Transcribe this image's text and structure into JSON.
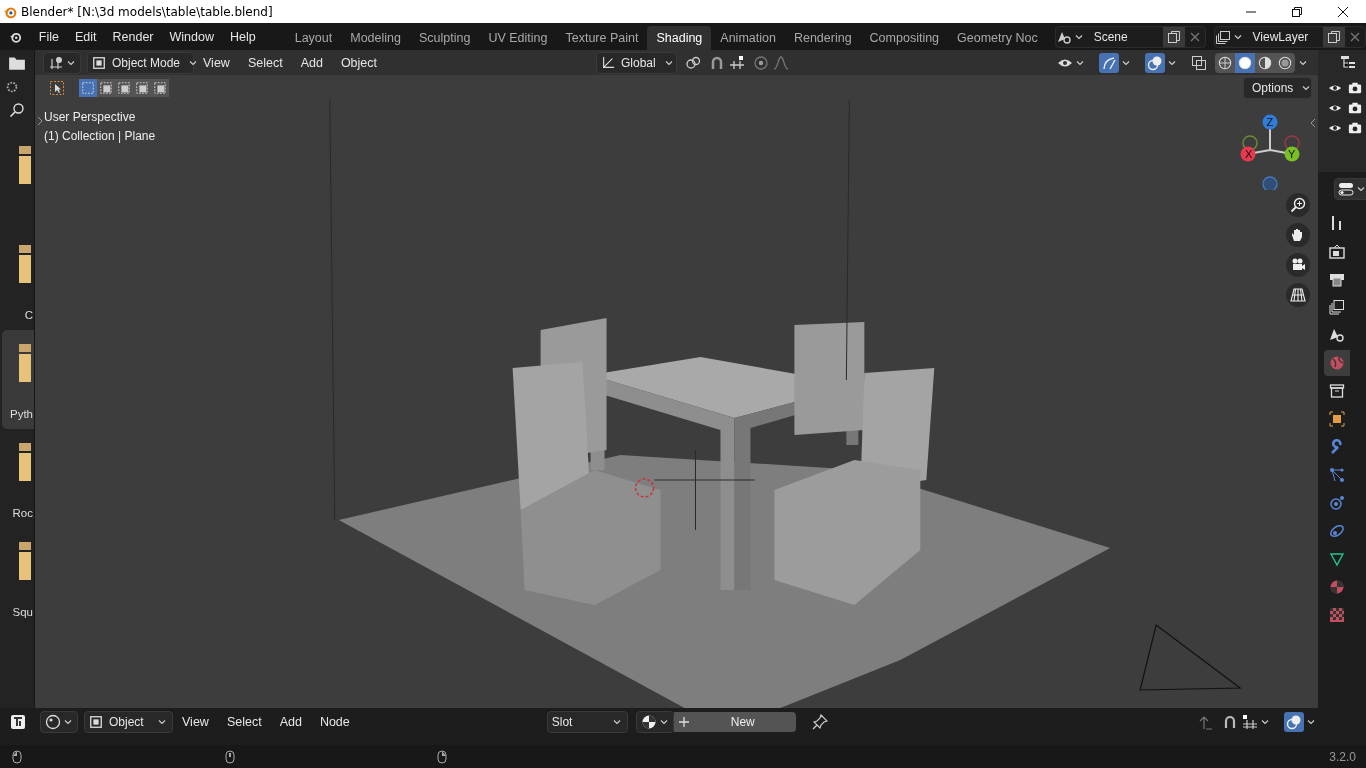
{
  "window": {
    "title": "Blender* [N:\\3d models\\table\\table.blend]"
  },
  "menu": [
    "File",
    "Edit",
    "Render",
    "Window",
    "Help"
  ],
  "workspaces": [
    {
      "label": "Layout",
      "selected": false
    },
    {
      "label": "Modeling",
      "selected": false
    },
    {
      "label": "Sculpting",
      "selected": false
    },
    {
      "label": "UV Editing",
      "selected": false
    },
    {
      "label": "Texture Paint",
      "selected": false
    },
    {
      "label": "Shading",
      "selected": true
    },
    {
      "label": "Animation",
      "selected": false
    },
    {
      "label": "Rendering",
      "selected": false
    },
    {
      "label": "Compositing",
      "selected": false
    },
    {
      "label": "Geometry Noc",
      "selected": false
    }
  ],
  "scene": {
    "name": "Scene"
  },
  "view_layer": {
    "name": "ViewLayer"
  },
  "asset_strip": {
    "items": [
      {
        "selected": false
      },
      {
        "label": "C",
        "selected": false
      },
      {
        "label": "Pyth",
        "selected": true
      },
      {
        "label": "Roc",
        "selected": false
      },
      {
        "label": "Squ",
        "selected": false
      }
    ]
  },
  "viewport": {
    "mode": "Object Mode",
    "menus": [
      "View",
      "Select",
      "Add",
      "Object"
    ],
    "orientation": "Global",
    "gizmos_on": true,
    "overlays_on": true,
    "select_modes": [
      {
        "selected": true
      },
      {
        "selected": false
      },
      {
        "selected": false
      },
      {
        "selected": false
      },
      {
        "selected": false
      }
    ],
    "shading_modes": [
      {
        "selected": false
      },
      {
        "selected": true
      },
      {
        "selected": false
      },
      {
        "selected": false
      }
    ],
    "options": "Options",
    "view_name": "User Perspective",
    "context": "(1) Collection | Plane",
    "axes": [
      "X",
      "Y",
      "Z"
    ]
  },
  "properties_tabs": [
    {
      "kind": "tool",
      "selected": false
    },
    {
      "kind": "render",
      "selected": false
    },
    {
      "kind": "output",
      "selected": false
    },
    {
      "kind": "viewlayer",
      "selected": false
    },
    {
      "kind": "scene",
      "selected": false
    },
    {
      "kind": "world",
      "selected": true
    },
    {
      "kind": "collection",
      "selected": false
    },
    {
      "kind": "object",
      "selected": false
    },
    {
      "kind": "modifier",
      "selected": false
    },
    {
      "kind": "particles",
      "selected": false
    },
    {
      "kind": "physics",
      "selected": false
    },
    {
      "kind": "constraint",
      "selected": false
    },
    {
      "kind": "data",
      "selected": false
    },
    {
      "kind": "material",
      "selected": false
    },
    {
      "kind": "texture",
      "selected": false
    }
  ],
  "node_editor": {
    "mode": "Object",
    "menus": [
      "View",
      "Select",
      "Add",
      "Node"
    ],
    "slot": "Slot",
    "new_button": "New",
    "overlays_on": true
  },
  "status_bar": {
    "version": "3.2.0"
  }
}
